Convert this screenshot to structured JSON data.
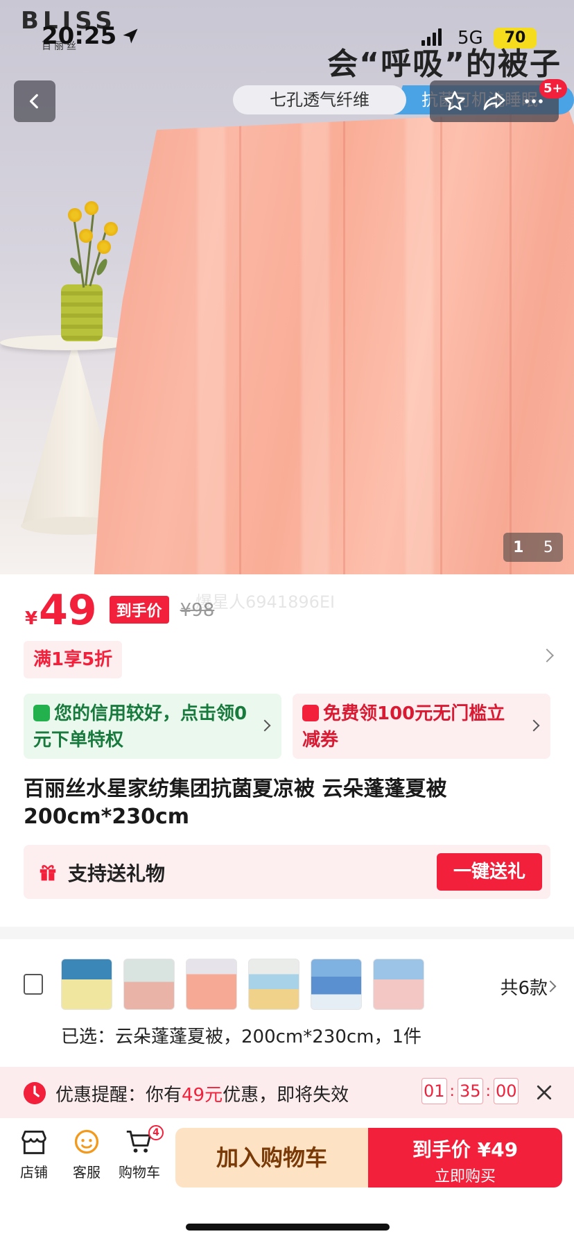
{
  "status_bar": {
    "time": "20:25",
    "network": "5G",
    "battery": "70"
  },
  "hero": {
    "brand": "BLISS",
    "brand_sub": "百丽丝",
    "slogan": "会“呼吸”的被子",
    "feature_pill_1": "七孔透气纤维",
    "feature_pill_2": "抗菌可机洗睡眠",
    "message_badge": "5+",
    "image_index": "1",
    "image_total": "5"
  },
  "price": {
    "currency": "¥",
    "amount": "49",
    "tag": "到手价",
    "original": "¥98",
    "watermark": "爆星人6941896EI"
  },
  "promotion": {
    "label": "满1享5折"
  },
  "cards": {
    "credit": "您的信用较好，点击领0元下单特权",
    "coupon": "免费领100元无门槛立减券"
  },
  "product": {
    "title": "百丽丝水星家纺集团抗菌夏凉被 云朵蓬蓬夏被 200cm*230cm"
  },
  "gift": {
    "label": "支持送礼物",
    "button": "一键送礼"
  },
  "variants": {
    "count_label": "共6款",
    "selected": "已选：云朵蓬蓬夏被，200cm*230cm，1件"
  },
  "reminder": {
    "prefix": "优惠提醒：你有",
    "amount": "49元",
    "suffix": "优惠，即将失效",
    "hours": "01",
    "minutes": "35",
    "seconds": "00"
  },
  "bottom": {
    "store": "店铺",
    "service": "客服",
    "cart": "购物车",
    "cart_count": "4",
    "add_to_cart": "加入购物车",
    "buy_price_label": "到手价 ¥49",
    "buy_now": "立即购买"
  },
  "colors": {
    "accent": "#f2203a",
    "cart_button": "#fde2c3",
    "quilt": "#f9ad97"
  }
}
